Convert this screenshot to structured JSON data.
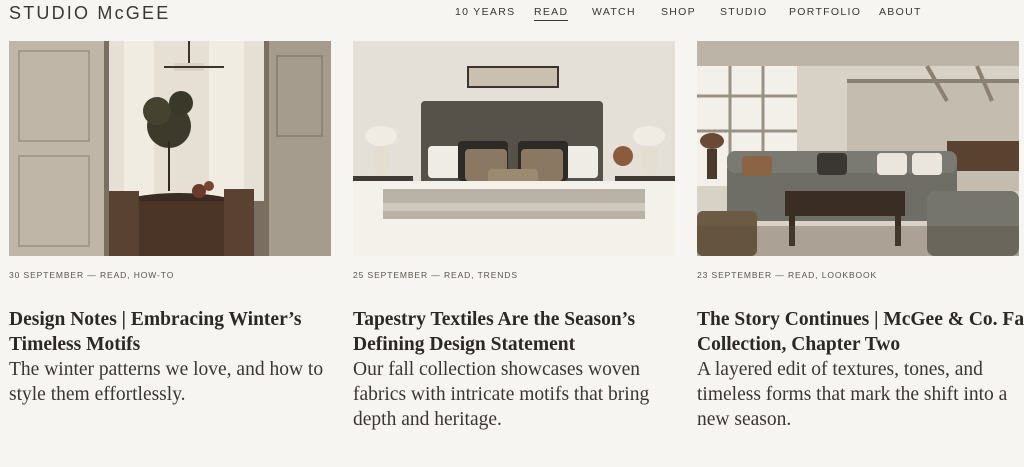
{
  "brand": {
    "logo": "STUDIO McGEE"
  },
  "nav": {
    "items": [
      {
        "label": "10 YEARS",
        "active": false
      },
      {
        "label": "READ",
        "active": true
      },
      {
        "label": "WATCH",
        "active": false
      },
      {
        "label": "SHOP",
        "active": false
      },
      {
        "label": "STUDIO",
        "active": false
      },
      {
        "label": "PORTFOLIO",
        "active": false
      },
      {
        "label": "ABOUT",
        "active": false
      }
    ]
  },
  "articles": [
    {
      "date": "30 SEPTEMBER",
      "separator": " — ",
      "categories": "READ, HOW-TO",
      "title": "Design Notes | Embracing Winter’s Timeless Motifs",
      "excerpt": "The winter patterns we love, and how to style them effortlessly."
    },
    {
      "date": "25 SEPTEMBER",
      "separator": " — ",
      "categories": "READ, TRENDS",
      "title": "Tapestry Textiles Are the Season’s Defining Design Statement",
      "excerpt": "Our fall collection showcases woven fabrics with intricate motifs that bring depth and heritage."
    },
    {
      "date": "23 SEPTEMBER",
      "separator": " — ",
      "categories": "READ, LOOKBOOK",
      "title": "The Story Continues | McGee & Co. Fall Collection, Chapter Two",
      "excerpt": "A layered edit of textures, tones, and timeless forms that mark the shift into a new season."
    }
  ],
  "colors": {
    "background": "#f7f5f1",
    "text": "#2b2825"
  }
}
